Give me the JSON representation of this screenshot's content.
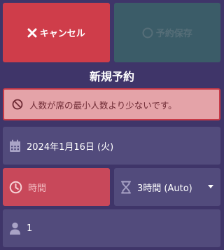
{
  "actions": {
    "cancel_label": "キャンセル",
    "save_label": "予約保存"
  },
  "page": {
    "title": "新規予約"
  },
  "alert": {
    "message": "人数が席の最小人数より少ないです。"
  },
  "form": {
    "date_value": "2024年1月16日 (火)",
    "time_placeholder": "時間",
    "duration_value": "3時間 (Auto)",
    "people_value": "1"
  },
  "icons": {
    "cancel": "close-icon",
    "save": "circle-icon",
    "alert": "ban-icon",
    "date": "calendar-icon",
    "time": "clock-icon",
    "duration": "hourglass-icon",
    "people": "person-icon",
    "dropdown": "caret-down-icon"
  },
  "colors": {
    "background": "#3f3569",
    "cancel_button": "#cf3d4a",
    "save_button_disabled": "#3b5c68",
    "alert_background": "#e4a3a8",
    "alert_border": "#c73a47",
    "field_background": "#524b7c",
    "time_field_error": "#c8485a"
  }
}
